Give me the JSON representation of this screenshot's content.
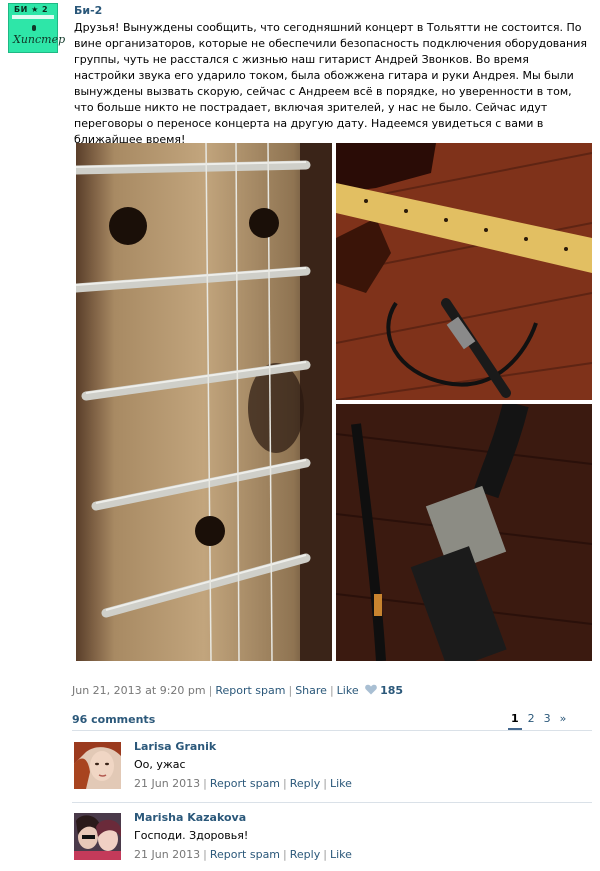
{
  "post": {
    "author": "Би-2",
    "avatar_text": "БИ ★ 2",
    "avatar_script": "Хипстер",
    "text": "Друзья! Вынуждены сообщить, что сегодняшний концерт в Тольятти не состоится. По вине организаторов, которые не обеспечили безопасность подключения оборудования группы, чуть не расстался с жизнью наш гитарист Андрей Звонков. Во время настройки звука его ударило током, была обожжена гитара и руки Андрея. Мы были вынуждены вызвать скорую, сейчас с Андреем всё в порядке, но уверенности в том, что больше никто не пострадает, включая зрителей, у нас не было. Сейчас идут переговоры о переносе концерта на другую дату. Надеемся увидеться с вами в ближайшее время!",
    "date": "Jun 21, 2013 at 9:20 pm",
    "report_spam": "Report spam",
    "share": "Share",
    "like": "Like",
    "like_count": "185",
    "heart_icon": "heart-icon"
  },
  "comments_section": {
    "count_label": "96 comments",
    "pages": [
      "1",
      "2",
      "3",
      "»"
    ],
    "active_page": "1"
  },
  "comments": [
    {
      "author": "Larisa Granik",
      "text": "Оо, ужас",
      "date": "21 Jun 2013",
      "report_spam": "Report spam",
      "reply": "Reply",
      "like": "Like"
    },
    {
      "author": "Marisha Kazakova",
      "text": "Господи. Здоровья!",
      "date": "21 Jun 2013",
      "report_spam": "Report spam",
      "reply": "Reply",
      "like": "Like"
    }
  ],
  "colors": {
    "link": "#2b587a",
    "muted": "#777777",
    "avatar_bg": "#2ee6a8"
  }
}
